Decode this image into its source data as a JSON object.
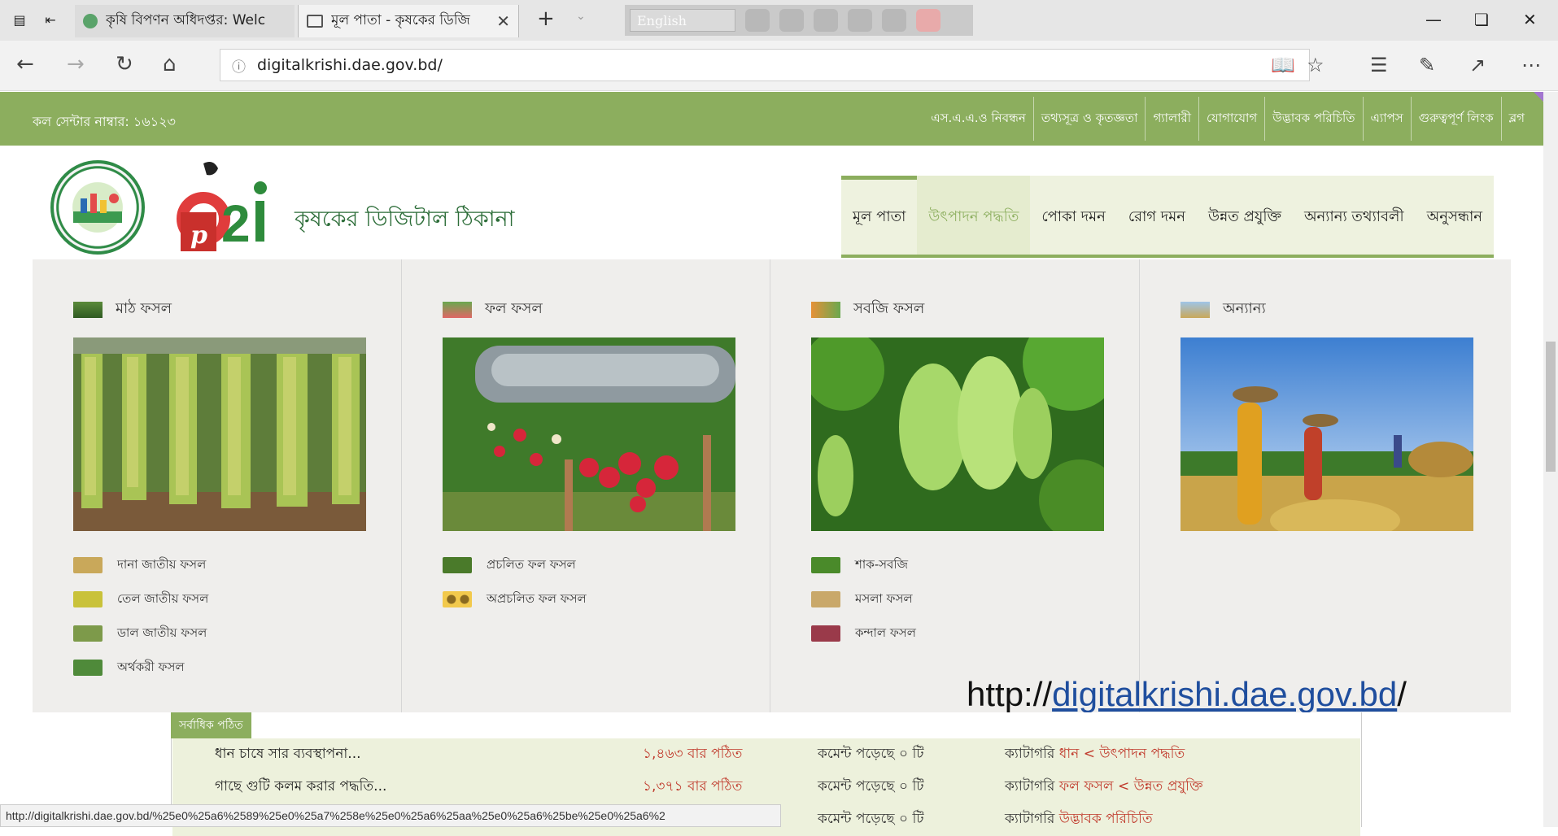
{
  "browser": {
    "tabs": [
      {
        "label": "কৃষি বিপণন অধিদপ্তর: Welc",
        "active": false
      },
      {
        "label": "মূল পাতা - কৃষকের ডিজি",
        "active": true
      }
    ],
    "language_button": "English",
    "url": "digitalkrishi.dae.gov.bd/",
    "status_url": "http://digitalkrishi.dae.gov.bd/%25e0%25a6%2589%25e0%25a7%258e%25e0%25a6%25aa%25e0%25a6%25be%25e0%25a6%2"
  },
  "site": {
    "call_center": "কল সেন্টার নাম্বার: ১৬১২৩",
    "top_nav": [
      "এস.এ.এ.ও নিবন্ধন",
      "তথ্যসূত্র ও কৃতজ্ঞতা",
      "গ্যালারী",
      "যোগাযোগ",
      "উদ্ভাবক পরিচিতি",
      "এ্যাপস",
      "গুরুত্বপূর্ণ লিংক",
      "ব্লগ"
    ],
    "brand": "কৃষকের ডিজিটাল ঠিকানা",
    "main_nav": [
      {
        "label": "মূল পাতা",
        "state": "active"
      },
      {
        "label": "উৎপাদন পদ্ধতি",
        "state": "hover"
      },
      {
        "label": "পোকা দমন",
        "state": ""
      },
      {
        "label": "রোগ দমন",
        "state": ""
      },
      {
        "label": "উন্নত প্রযুক্তি",
        "state": ""
      },
      {
        "label": "অন্যান্য তথ্যাবলী",
        "state": ""
      },
      {
        "label": "অনুসন্ধান",
        "state": ""
      }
    ],
    "mega_menu": [
      {
        "title": "মাঠ ফসল",
        "items": [
          "দানা জাতীয় ফসল",
          "তেল জাতীয় ফসল",
          "ডাল জাতীয় ফসল",
          "অর্থকরী ফসল"
        ]
      },
      {
        "title": "ফল ফসল",
        "items": [
          "প্রচলিত ফল ফসল",
          "অপ্রচলিত ফল ফসল"
        ]
      },
      {
        "title": "সবজি ফসল",
        "items": [
          "শাক-সবজি",
          "মসলা ফসল",
          "কন্দাল ফসল"
        ]
      },
      {
        "title": "অন্যান্য",
        "items": []
      }
    ],
    "caption_prefix": "http://",
    "caption_link": "digitalkrishi.dae.gov.bd",
    "caption_suffix": "/",
    "most_read_title": "সর্বাধিক পঠিত",
    "most_read": [
      {
        "title": "ধান চাষে সার ব্যবস্থাপনা...",
        "reads": "১,৪৬৩ বার পঠিত",
        "comments": "কমেন্ট পড়েছে ০ টি",
        "cat_label": "ক্যাটাগরি",
        "cat": "ধান < উৎপাদন পদ্ধতি"
      },
      {
        "title": "গাছে গুটি কলম করার পদ্ধতি...",
        "reads": "১,৩৭১ বার পঠিত",
        "comments": "কমেন্ট পড়েছে ০ টি",
        "cat_label": "ক্যাটাগরি",
        "cat": "ফল ফসল < উন্নত প্রযুক্তি"
      },
      {
        "title": "",
        "reads": "",
        "comments": "কমেন্ট পড়েছে ০ টি",
        "cat_label": "ক্যাটাগরি",
        "cat": "উদ্ভাবক পরিচিতি"
      }
    ]
  },
  "colors": {
    "site_green": "#8cae5e",
    "nav_bg": "#eef2df",
    "accent_red": "#c0392b",
    "link_blue": "#1f4e9e"
  }
}
